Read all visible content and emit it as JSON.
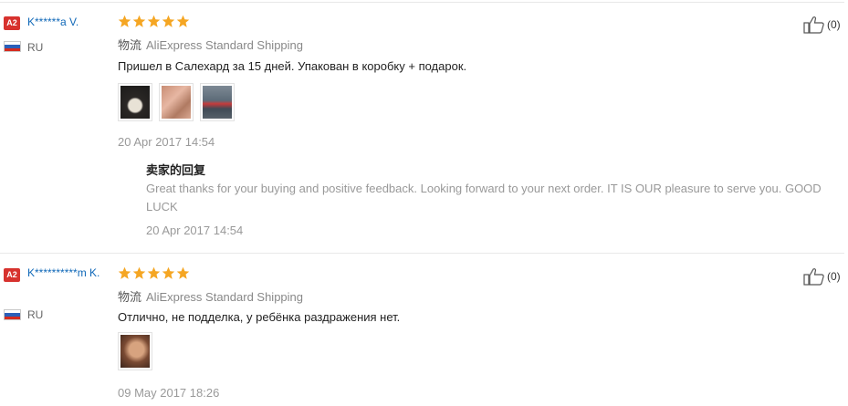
{
  "reviews": [
    {
      "badge": "A2",
      "name": "K******a V.",
      "country": "RU",
      "rating": 5,
      "logistics_label": "物流",
      "logistics_value": "AliExpress Standard Shipping",
      "text": "Пришел в Салехард за 15 дней. Упакован в коробку + подарок.",
      "photos": [
        "photo-box",
        "photo-necklace",
        "photo-package"
      ],
      "date": "20 Apr 2017 14:54",
      "helpful_count": "(0)",
      "reply": {
        "title": "卖家的回复",
        "text": "Great thanks for your buying and positive feedback. Looking forward to your next order. IT IS OUR pleasure to serve you. GOOD LUCK",
        "date": "20 Apr 2017 14:54"
      }
    },
    {
      "badge": "A2",
      "name": "K**********m K.",
      "country": "RU",
      "rating": 5,
      "logistics_label": "物流",
      "logistics_value": "AliExpress Standard Shipping",
      "text": "Отлично, не подделка, у ребёнка раздражения нет.",
      "photos": [
        "photo-hand"
      ],
      "date": "09 May 2017 18:26",
      "helpful_count": "(0)"
    }
  ],
  "colors": {
    "star": "#f5a623",
    "name_link": "#1068b8",
    "badge": "#d7322e"
  },
  "icons": {
    "star": "star-icon",
    "helpful": "thumbs-up-icon",
    "flag": "russia-flag-icon"
  }
}
